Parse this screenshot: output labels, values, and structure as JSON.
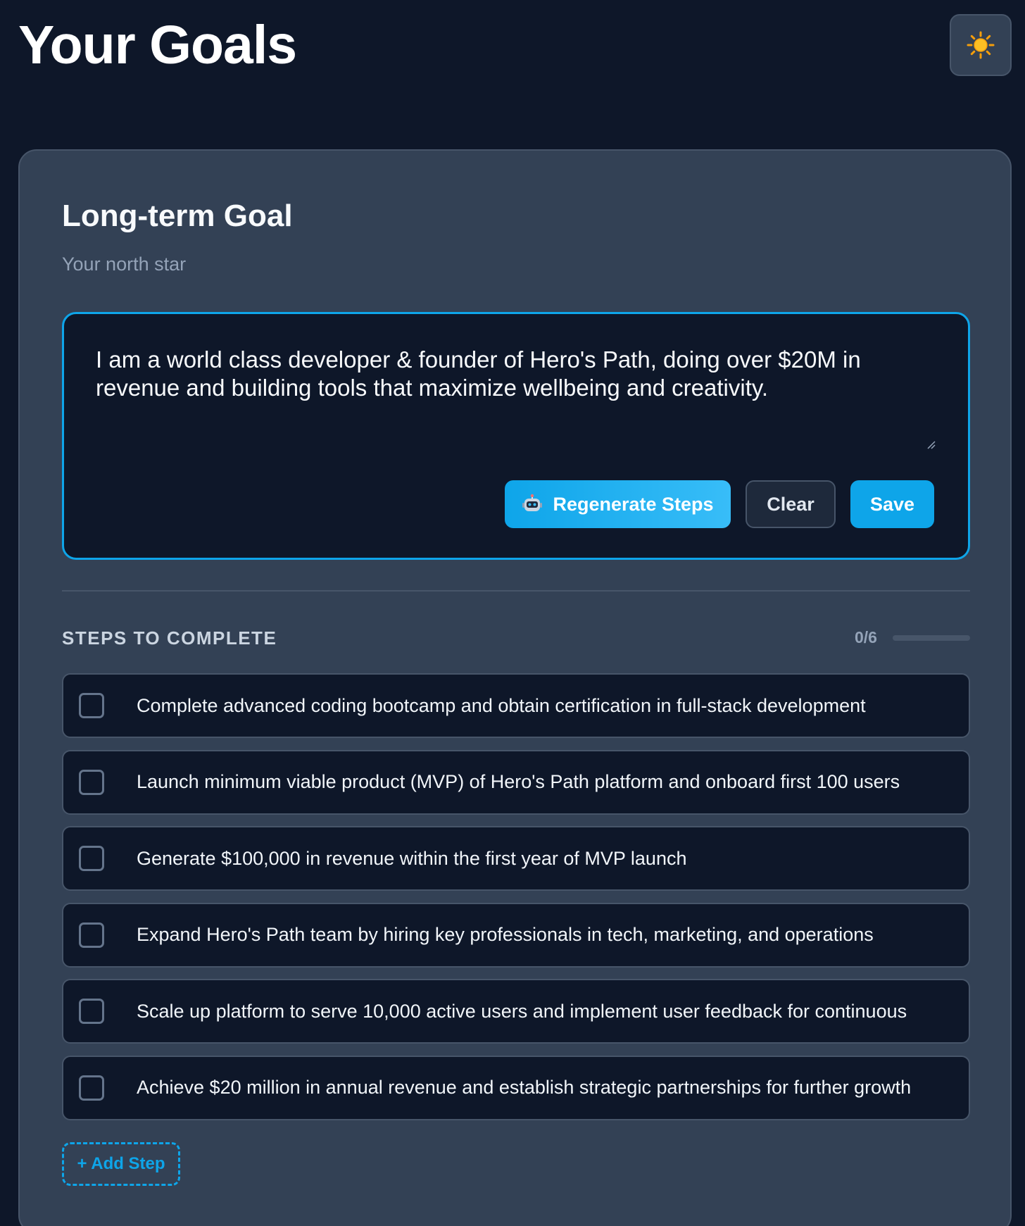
{
  "header": {
    "title": "Your Goals",
    "theme_toggle_icon": "sun-icon"
  },
  "goal_card": {
    "title": "Long-term Goal",
    "subtitle": "Your north star",
    "goal_text": "I am a world class developer & founder of Hero's Path, doing over $20M in revenue and building tools that maximize wellbeing and creativity.",
    "buttons": {
      "regenerate_icon": "robot-icon",
      "regenerate_label": "Regenerate Steps",
      "clear_label": "Clear",
      "save_label": "Save"
    }
  },
  "steps": {
    "heading": "STEPS TO COMPLETE",
    "progress_text": "0/6",
    "progress_fraction": 0,
    "items": [
      {
        "label": "Complete advanced coding bootcamp and obtain certification in full-stack development",
        "checked": false
      },
      {
        "label": "Launch minimum viable product (MVP) of Hero's Path platform and onboard first 100 users",
        "checked": false
      },
      {
        "label": "Generate $100,000 in revenue within the first year of MVP launch",
        "checked": false
      },
      {
        "label": "Expand Hero's Path team by hiring key professionals in tech, marketing, and operations",
        "checked": false
      },
      {
        "label": "Scale up platform to serve 10,000 active users and implement user feedback for continuous",
        "checked": false
      },
      {
        "label": "Achieve $20 million in annual revenue and establish strategic partnerships for further growth",
        "checked": false
      }
    ],
    "add_step_label": "+ Add Step"
  },
  "colors": {
    "background": "#0e1729",
    "card": "#334155",
    "accent": "#0ea5e9",
    "text": "#f1f5f9",
    "muted": "#94a3b8"
  }
}
